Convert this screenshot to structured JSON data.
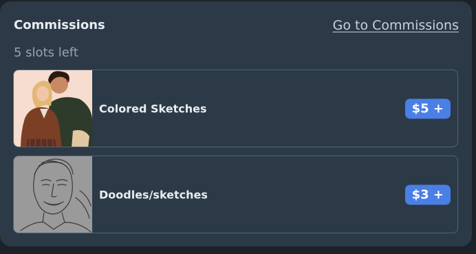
{
  "commissions": {
    "title": "Commissions",
    "link_label": "Go to Commissions",
    "slots_text": "5 slots left",
    "accent_color": "#4a7fe6",
    "items": [
      {
        "name": "Colored Sketches",
        "price": "$5 +",
        "thumbnail": "colored-couple-illustration"
      },
      {
        "name": "Doodles/sketches",
        "price": "$3 +",
        "thumbnail": "pencil-portrait-sketch"
      }
    ]
  }
}
